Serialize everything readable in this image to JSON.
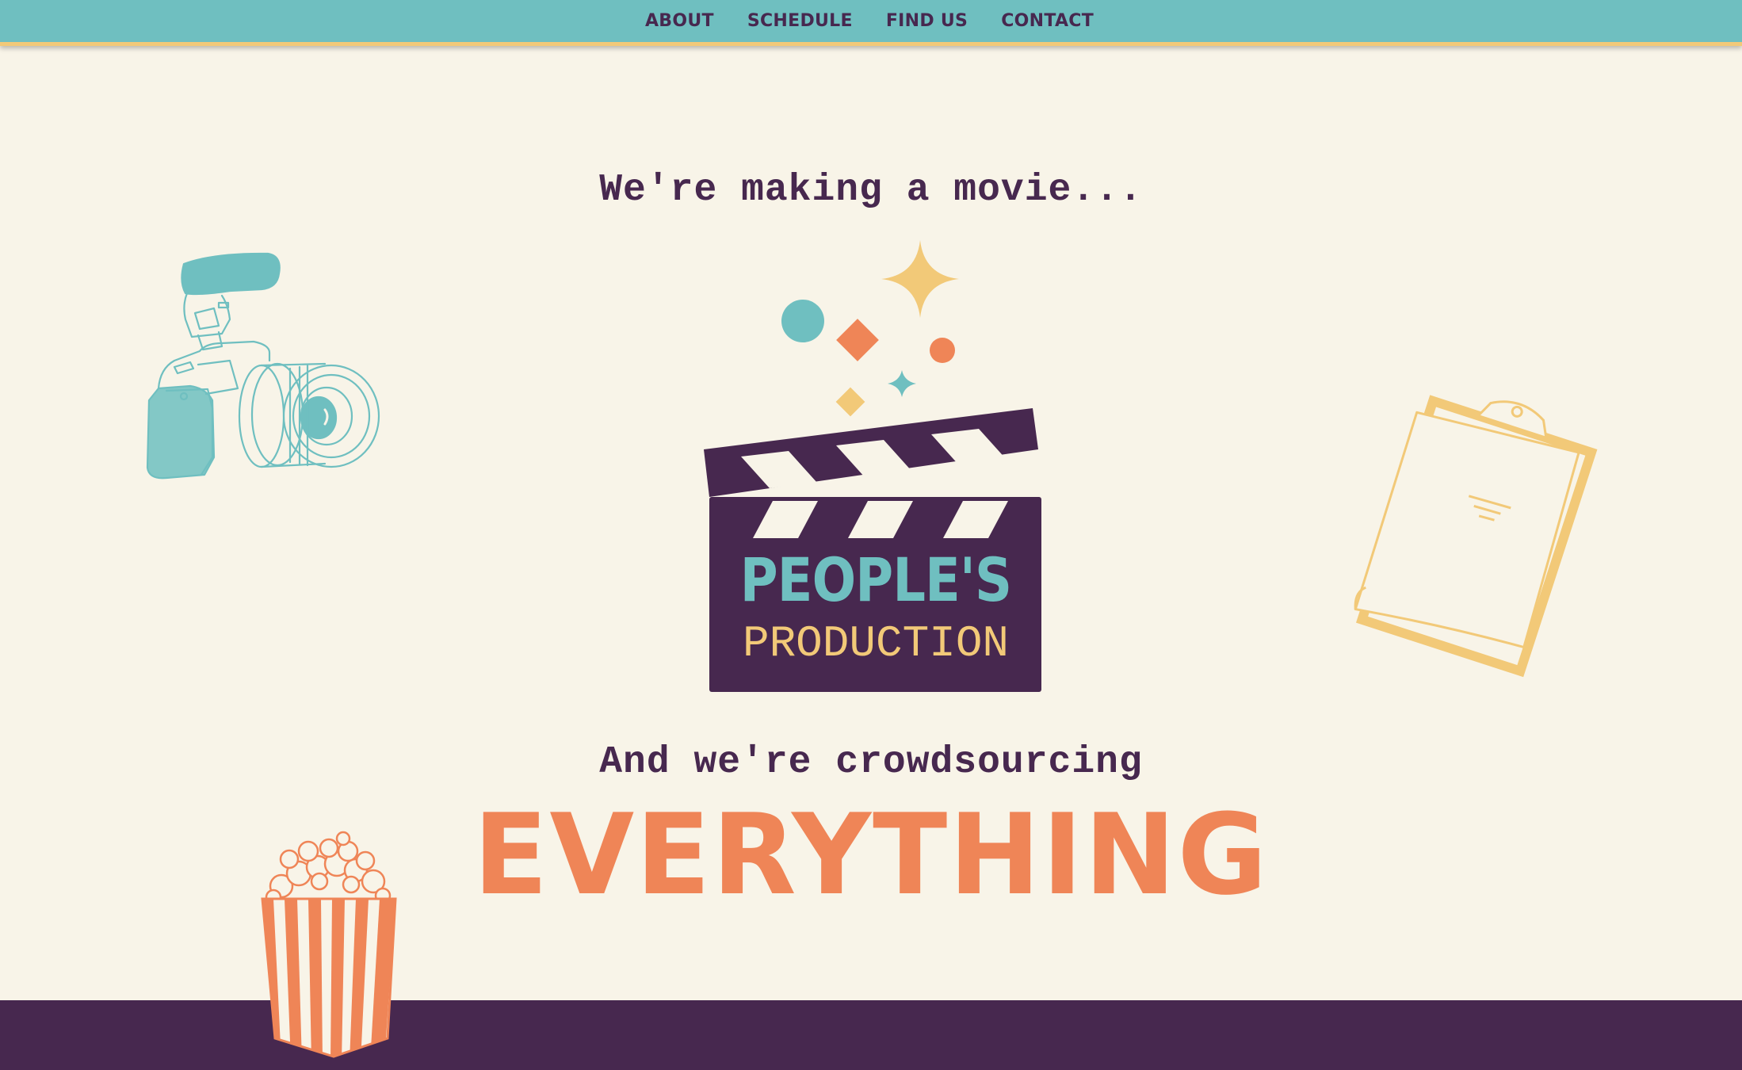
{
  "nav": {
    "items": [
      {
        "label": "ABOUT"
      },
      {
        "label": "SCHEDULE"
      },
      {
        "label": "FIND US"
      },
      {
        "label": "CONTACT"
      }
    ]
  },
  "hero": {
    "intro": "We're making a movie...",
    "logo": {
      "line1": "PEOPLE'S",
      "line2": "PRODUCTION"
    },
    "crowd_text": "And we're crowdsourcing",
    "headline": "EVERYTHING"
  },
  "colors": {
    "teal": "#6fbfc0",
    "cream": "#f8f4e8",
    "purple": "#47284f",
    "orange": "#ef8557",
    "yellow": "#f2c978"
  },
  "icons": [
    "camera-icon",
    "clipboard-icon",
    "popcorn-icon",
    "clapperboard-icon",
    "sparkle-icon"
  ]
}
